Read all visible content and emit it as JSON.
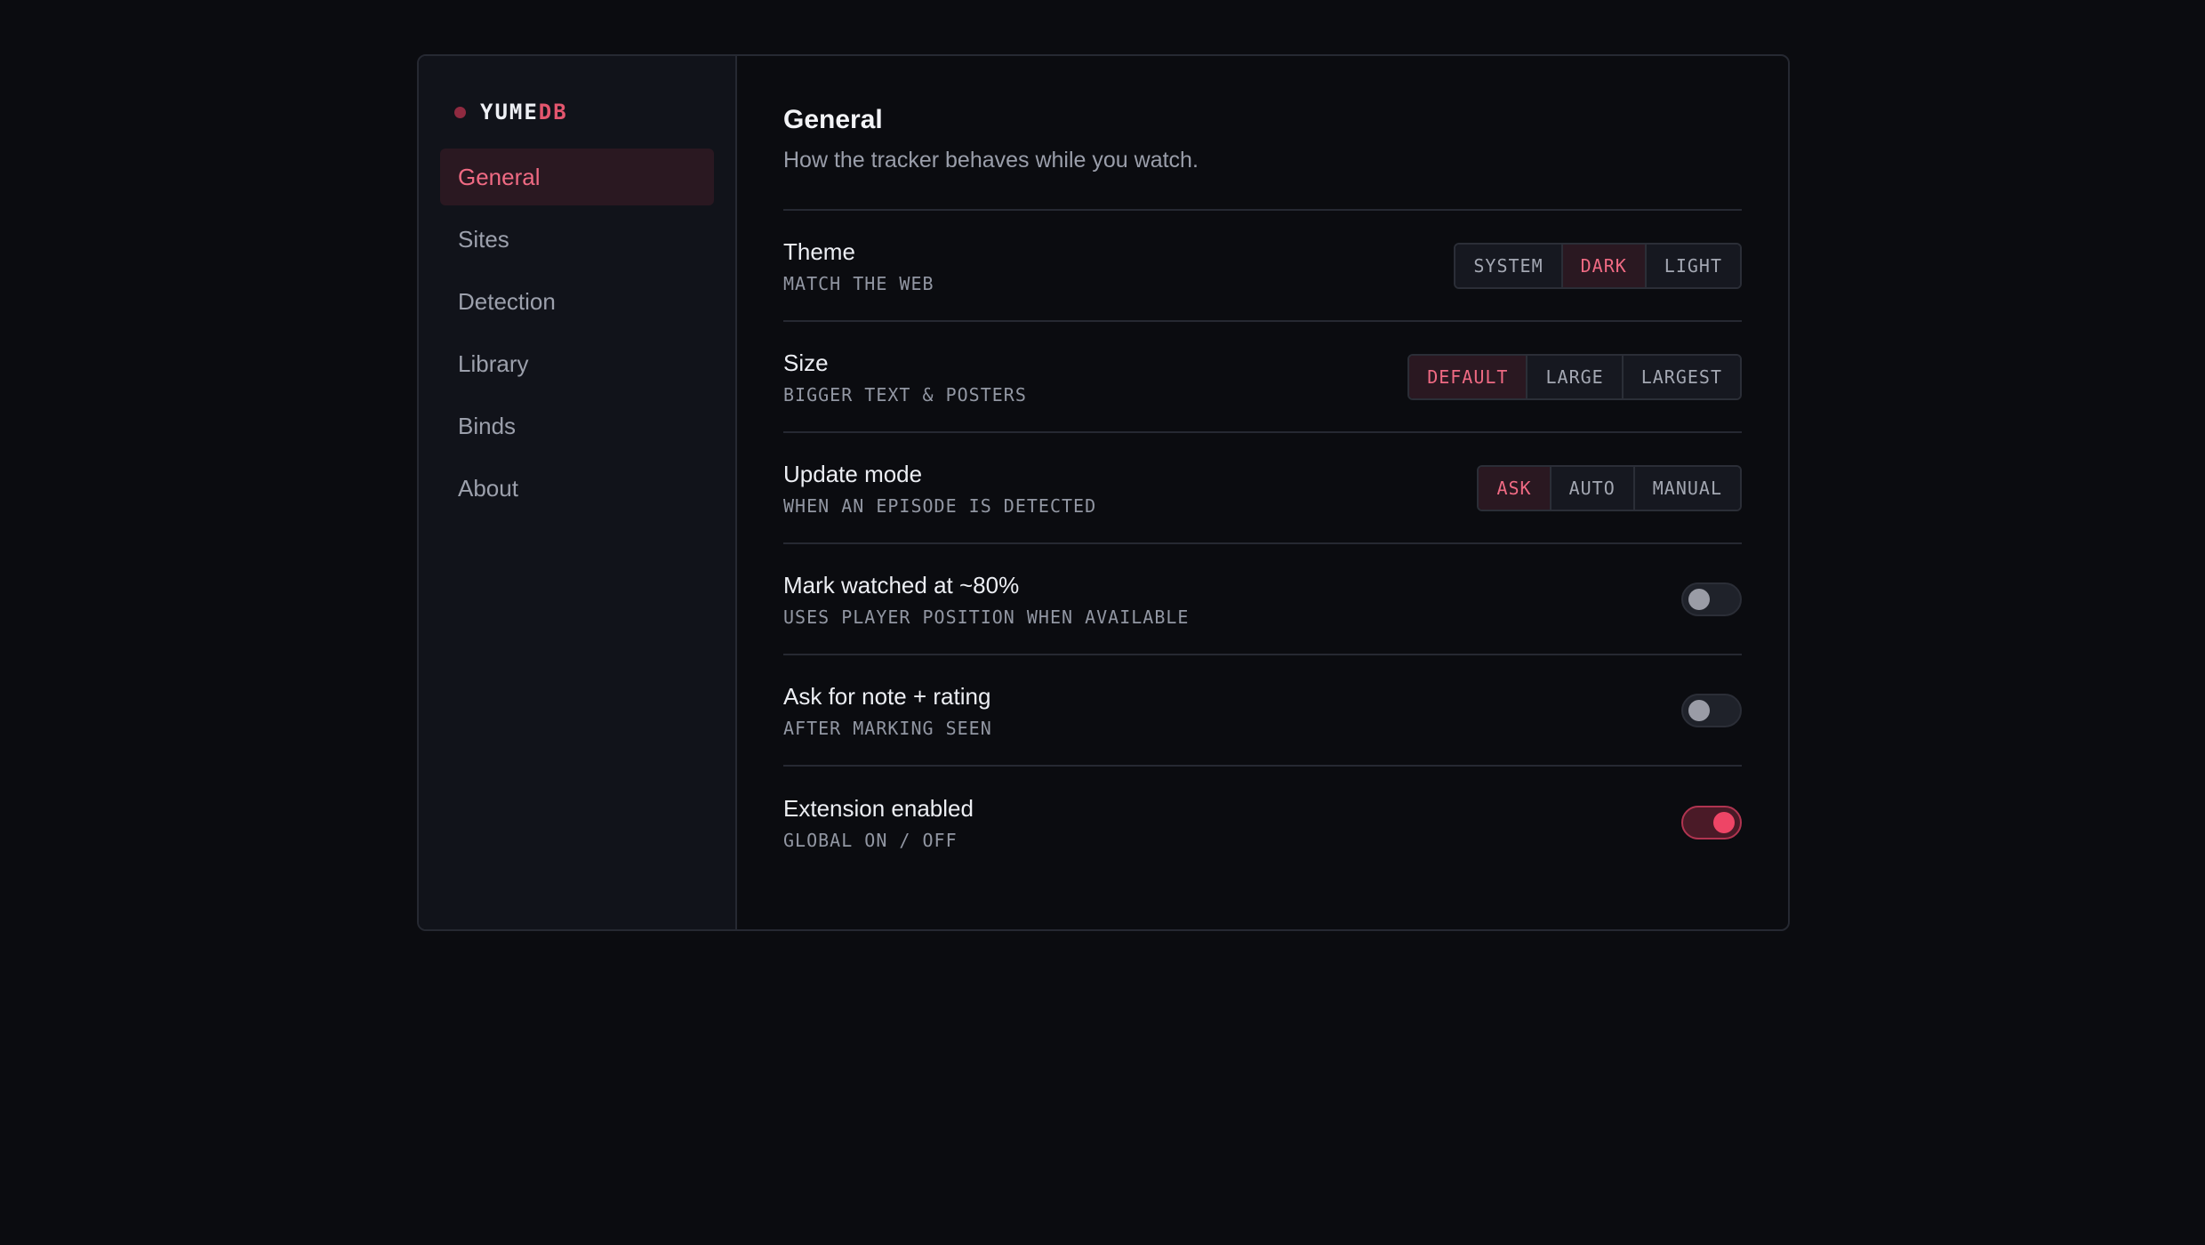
{
  "brand": {
    "name_main": "YUME",
    "name_accent": "DB"
  },
  "sidebar": {
    "items": [
      {
        "label": "General",
        "active": true
      },
      {
        "label": "Sites",
        "active": false
      },
      {
        "label": "Detection",
        "active": false
      },
      {
        "label": "Library",
        "active": false
      },
      {
        "label": "Binds",
        "active": false
      },
      {
        "label": "About",
        "active": false
      }
    ]
  },
  "main": {
    "title": "General",
    "subtitle": "How the tracker behaves while you watch.",
    "settings": {
      "theme": {
        "title": "Theme",
        "desc": "MATCH THE WEB",
        "options": [
          "SYSTEM",
          "DARK",
          "LIGHT"
        ],
        "selected": "DARK"
      },
      "size": {
        "title": "Size",
        "desc": "BIGGER TEXT & POSTERS",
        "options": [
          "DEFAULT",
          "LARGE",
          "LARGEST"
        ],
        "selected": "DEFAULT"
      },
      "update_mode": {
        "title": "Update mode",
        "desc": "WHEN AN EPISODE IS DETECTED",
        "options": [
          "ASK",
          "AUTO",
          "MANUAL"
        ],
        "selected": "ASK"
      },
      "mark_watched": {
        "title": "Mark watched at ~80%",
        "desc": "USES PLAYER POSITION WHEN AVAILABLE",
        "enabled": false
      },
      "ask_note": {
        "title": "Ask for note + rating",
        "desc": "AFTER MARKING SEEN",
        "enabled": false
      },
      "extension": {
        "title": "Extension enabled",
        "desc": "GLOBAL ON / OFF",
        "enabled": true
      }
    }
  },
  "colors": {
    "accent": "#ef6a83",
    "toggle_on": "#ee4566",
    "background": "#0b0c10",
    "sidebar": "#11131a"
  }
}
